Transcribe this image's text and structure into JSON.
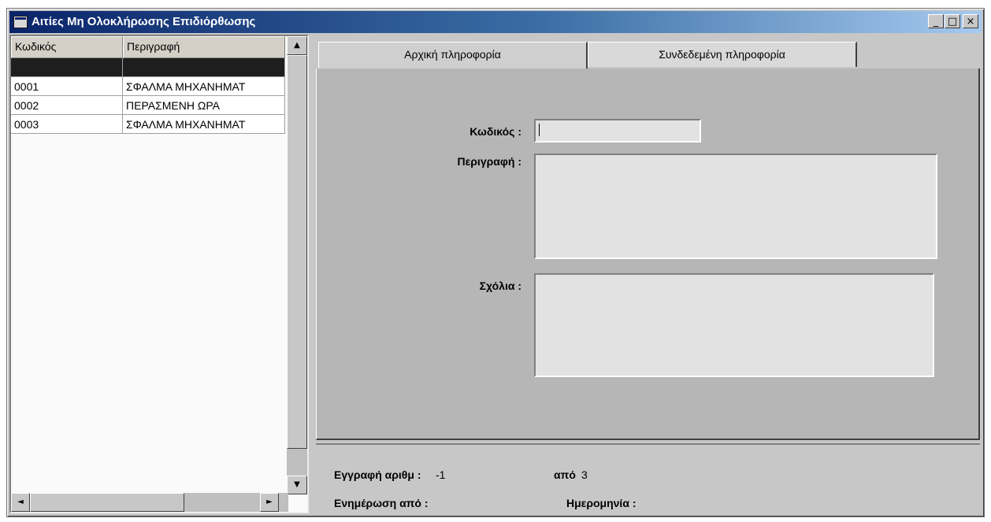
{
  "window": {
    "title": "Αιτίες Μη Ολοκλήρωσης Επιδιόρθωσης",
    "minimize_label": "_",
    "maximize_label": "□",
    "close_label": "×"
  },
  "grid": {
    "columns": [
      "Κωδικός",
      "Περιγραφή"
    ],
    "rows": [
      {
        "code": "",
        "description": ""
      },
      {
        "code": "0001",
        "description": "ΣΦΑΛΜΑ ΜΗΧΑΝΗΜΑΤ"
      },
      {
        "code": "0002",
        "description": "ΠΕΡΑΣΜΕΝΗ ΩΡΑ"
      },
      {
        "code": "0003",
        "description": "ΣΦΑΛΜΑ ΜΗΧΑΝΗΜΑΤ"
      }
    ],
    "scroll_up_icon": "▲",
    "scroll_down_icon": "▼",
    "scroll_left_icon": "◄",
    "scroll_right_icon": "►"
  },
  "tabs": [
    {
      "label": "Αρχική πληροφορία"
    },
    {
      "label": "Συνδεδεμένη πληροφορία"
    }
  ],
  "form": {
    "code_label": "Κωδικός :",
    "code_value": "",
    "description_label": "Περιγραφή :",
    "description_value": "",
    "comments_label": "Σχόλια :",
    "comments_value": ""
  },
  "status": {
    "record_label": "Εγγραφή αριθμ :",
    "record_value": "-1",
    "of_label": "από",
    "of_value": "3",
    "updated_by_label": "Ενημέρωση από :",
    "updated_by_value": "",
    "date_label": "Ημερομηνία :",
    "date_value": ""
  }
}
